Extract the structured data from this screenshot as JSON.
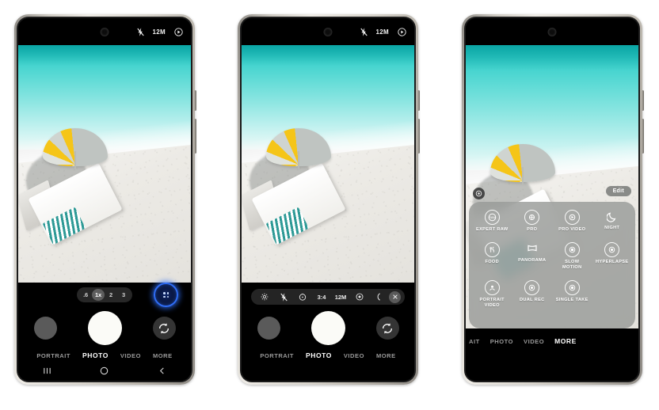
{
  "page": {
    "title": "Samsung Galaxy Camera app — three-step guide to opening MORE camera modes",
    "background": "#ffffff"
  },
  "colors": {
    "accent_highlight": "#2f6df6",
    "sea": "#18c4c1",
    "sand": "#eceae5",
    "umbrella_yellow": "#f5c518",
    "towel_teal": "#2e9a96",
    "frame_metal": "#cfcbc3",
    "screen_black": "#000000",
    "sheet_grey": "#969896"
  },
  "phones": [
    {
      "id": "phone-1",
      "caption_role": "step-1-camera-viewfinder",
      "status_bar": {
        "visible": true,
        "icons": [
          "flash-off-icon",
          "motion-photo-icon"
        ],
        "resolution_label": "12M"
      },
      "zoom_pills": [
        {
          "label": ".6",
          "active": false
        },
        {
          "label": "1x",
          "active": true
        },
        {
          "label": "2",
          "active": false
        },
        {
          "label": "3",
          "active": false
        }
      ],
      "highlight": {
        "visible": true,
        "target": "camera-settings-grid-button",
        "color": "#2f6df6"
      },
      "settings_bar": {
        "visible": false,
        "items": []
      },
      "shutter_row": {
        "thumbnail": "gallery-thumbnail",
        "shutter": "shutter-button",
        "flip": "switch-camera-icon"
      },
      "mode_tabs": [
        {
          "label": "PORTRAIT",
          "active": false
        },
        {
          "label": "PHOTO",
          "active": true
        },
        {
          "label": "VIDEO",
          "active": false
        },
        {
          "label": "MORE",
          "active": false
        }
      ],
      "nav_bar": {
        "visible": true,
        "items": [
          "recents-icon",
          "home-icon",
          "back-icon"
        ]
      },
      "more_sheet": {
        "visible": false
      }
    },
    {
      "id": "phone-2",
      "caption_role": "step-2-settings-bar-expanded",
      "status_bar": {
        "visible": true,
        "icons": [
          "flash-off-icon",
          "motion-photo-icon"
        ],
        "resolution_label": "12M"
      },
      "zoom_pills": [],
      "highlight": {
        "visible": false
      },
      "settings_bar": {
        "visible": true,
        "items": [
          {
            "name": "settings-gear-icon",
            "label": ""
          },
          {
            "name": "flash-off-icon",
            "label": ""
          },
          {
            "name": "timer-icon",
            "label": ""
          },
          {
            "name": "aspect-ratio-label",
            "label": "3:4"
          },
          {
            "name": "resolution-label",
            "label": "12M"
          },
          {
            "name": "motion-photo-icon",
            "label": ""
          },
          {
            "name": "filter-icon",
            "label": ""
          },
          {
            "name": "close-settings-button",
            "label": ""
          }
        ]
      },
      "shutter_row": {
        "thumbnail": "gallery-thumbnail",
        "shutter": "shutter-button",
        "flip": "switch-camera-icon"
      },
      "mode_tabs": [
        {
          "label": "PORTRAIT",
          "active": false
        },
        {
          "label": "PHOTO",
          "active": true
        },
        {
          "label": "VIDEO",
          "active": false
        },
        {
          "label": "MORE",
          "active": false
        }
      ],
      "nav_bar": {
        "visible": false,
        "items": []
      },
      "more_sheet": {
        "visible": false
      }
    },
    {
      "id": "phone-3",
      "caption_role": "step-3-more-modes-panel",
      "status_bar": {
        "visible": false,
        "icons": [],
        "resolution_label": ""
      },
      "zoom_pills": [],
      "highlight": {
        "visible": false
      },
      "settings_bar": {
        "visible": false,
        "items": []
      },
      "shutter_row": null,
      "mode_tabs": [
        {
          "label": "AIT",
          "active": false
        },
        {
          "label": "PHOTO",
          "active": false
        },
        {
          "label": "VIDEO",
          "active": false
        },
        {
          "label": "MORE",
          "active": true
        }
      ],
      "nav_bar": {
        "visible": false,
        "items": []
      },
      "more_sheet": {
        "visible": true,
        "edit_label": "Edit",
        "lens_chip": "lens-eye-icon",
        "modes": [
          {
            "label": "EXPERT RAW",
            "icon": "expert-raw-icon"
          },
          {
            "label": "PRO",
            "icon": "pro-icon"
          },
          {
            "label": "PRO VIDEO",
            "icon": "pro-video-icon"
          },
          {
            "label": "NIGHT",
            "icon": "night-moon-icon"
          },
          {
            "label": "FOOD",
            "icon": "food-icon"
          },
          {
            "label": "PANORAMA",
            "icon": "panorama-icon"
          },
          {
            "label": "SLOW\nMOTION",
            "icon": "slow-motion-icon"
          },
          {
            "label": "HYPERLAPSE",
            "icon": "hyperlapse-icon"
          },
          {
            "label": "PORTRAIT\nVIDEO",
            "icon": "portrait-video-icon"
          },
          {
            "label": "DUAL REC",
            "icon": "dual-rec-icon"
          },
          {
            "label": "SINGLE TAKE",
            "icon": "single-take-icon"
          }
        ]
      }
    }
  ]
}
